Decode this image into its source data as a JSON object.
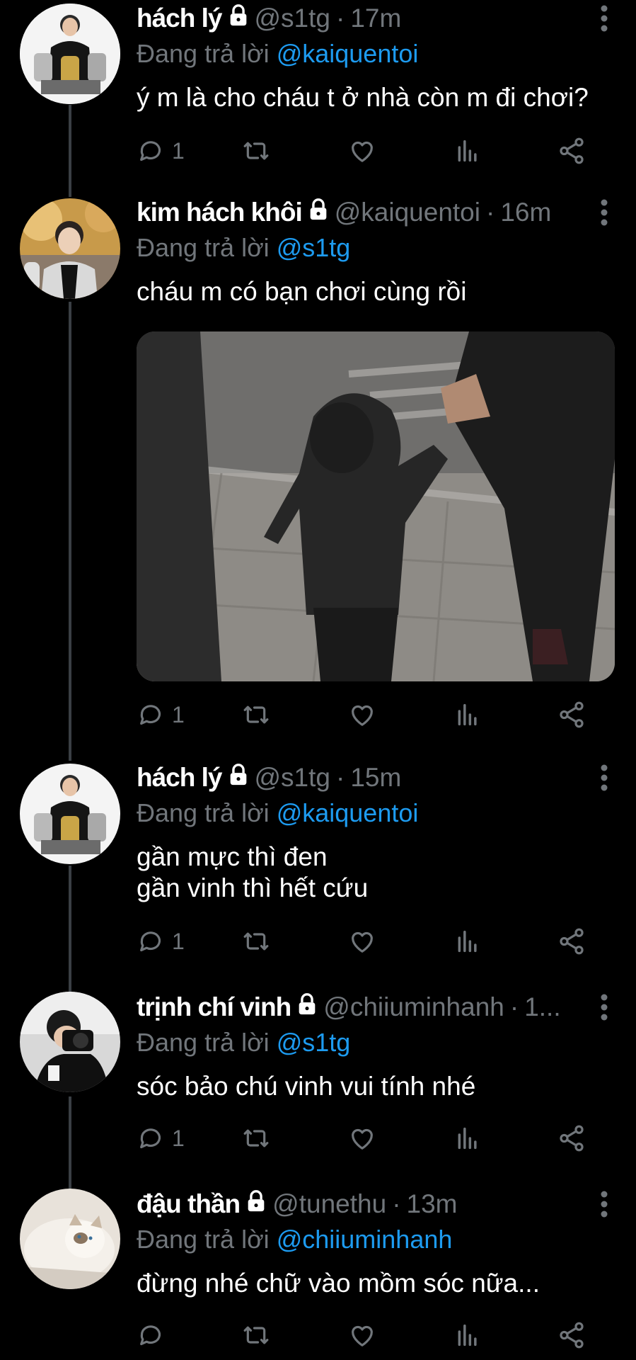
{
  "tweets": [
    {
      "name": "hách lý",
      "handle": "@s1tg",
      "time": "17m",
      "reply_prefix": "Đang trả lời",
      "reply_to": "@kaiquentoi",
      "text": "ý m là cho cháu t ở nhà còn m đi chơi?",
      "reply_count": "1",
      "avatar": "player-with-trophies"
    },
    {
      "name": "kim hách khôi",
      "handle": "@kaiquentoi",
      "time": "16m",
      "reply_prefix": "Đang trả lời",
      "reply_to": "@s1tg",
      "text": "cháu m có bạn chơi cùng rồi",
      "reply_count": "1",
      "avatar": "young-man-outdoors",
      "media": "photo-child-holding-hand"
    },
    {
      "name": "hách lý",
      "handle": "@s1tg",
      "time": "15m",
      "reply_prefix": "Đang trả lời",
      "reply_to": "@kaiquentoi",
      "text": "gần mực thì đen\ngần vinh thì hết cứu",
      "reply_count": "1",
      "avatar": "player-with-trophies"
    },
    {
      "name": "trịnh chí vinh",
      "handle": "@chiiuminhanh",
      "time": "1...",
      "reply_prefix": "Đang trả lời",
      "reply_to": "@s1tg",
      "text": "sóc bảo chú vinh vui tính nhé",
      "reply_count": "1",
      "avatar": "man-with-camera"
    },
    {
      "name": "đậu thần",
      "handle": "@tunethu",
      "time": "13m",
      "reply_prefix": "Đang trả lời",
      "reply_to": "@chiiuminhanh",
      "text": "đừng nhé chữ vào mồm sóc nữa...",
      "reply_count": "",
      "avatar": "fluffy-cat"
    }
  ],
  "icons": {
    "lock": "lock-icon",
    "more": "more-vertical-icon",
    "reply": "reply-icon",
    "retweet": "retweet-icon",
    "like": "like-icon",
    "views": "views-icon",
    "share": "share-icon"
  },
  "colors": {
    "background": "#000000",
    "name": "#ffffff",
    "secondary": "#71767b",
    "mention": "#1d9bf0",
    "thread_line": "#3a3f44"
  }
}
